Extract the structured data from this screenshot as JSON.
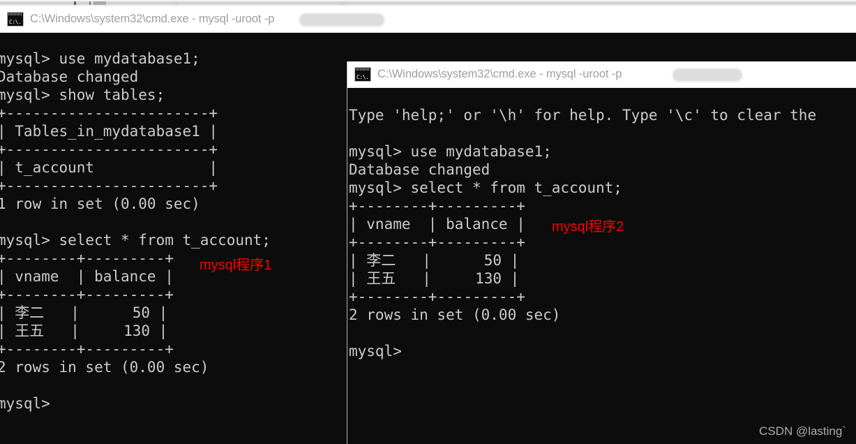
{
  "window1": {
    "title": "C:\\Windows\\system32\\cmd.exe - mysql  -uroot -p",
    "icon": "cmd-icon",
    "redacted_password": true,
    "terminal_text": "mysql> use mydatabase1;\nDatabase changed\nmysql> show tables;\n+-----------------------+\n| Tables_in_mydatabase1 |\n+-----------------------+\n| t_account             |\n+-----------------------+\n1 row in set (0.00 sec)\n\nmysql> select * from t_account;\n+--------+---------+\n| vname  | balance |\n+--------+---------+\n| 李二   |      50 |\n| 王五   |     130 |\n+--------+---------+\n2 rows in set (0.00 sec)\n\nmysql>",
    "annotation": "mysql程序1",
    "annotation_color": "#ff0000",
    "result_table": {
      "columns": [
        "vname",
        "balance"
      ],
      "rows": [
        [
          "李二",
          "50"
        ],
        [
          "王五",
          "130"
        ]
      ],
      "row_count_text": "2 rows in set (0.00 sec)"
    },
    "tables_listing": {
      "column": "Tables_in_mydatabase1",
      "rows": [
        "t_account"
      ],
      "row_count_text": "1 row in set (0.00 sec)"
    },
    "commands": [
      "use mydatabase1;",
      "show tables;",
      "select * from t_account;"
    ],
    "prompt": "mysql>"
  },
  "window2": {
    "title": "C:\\Windows\\system32\\cmd.exe - mysql  -uroot -p",
    "icon": "cmd-icon",
    "redacted_password": true,
    "terminal_text": "Type 'help;' or '\\h' for help. Type '\\c' to clear the\n\nmysql> use mydatabase1;\nDatabase changed\nmysql> select * from t_account;\n+--------+---------+\n| vname  | balance |\n+--------+---------+\n| 李二   |      50 |\n| 王五   |     130 |\n+--------+---------+\n2 rows in set (0.00 sec)\n\nmysql>",
    "annotation": "mysql程序2",
    "annotation_color": "#ff0000",
    "help_line": "Type 'help;' or '\\h' for help. Type '\\c' to clear the",
    "result_table": {
      "columns": [
        "vname",
        "balance"
      ],
      "rows": [
        [
          "李二",
          "50"
        ],
        [
          "王五",
          "130"
        ]
      ],
      "row_count_text": "2 rows in set (0.00 sec)"
    },
    "commands": [
      "use mydatabase1;",
      "select * from t_account;"
    ],
    "prompt": "mysql>"
  },
  "watermark": "CSDN @lasting`"
}
